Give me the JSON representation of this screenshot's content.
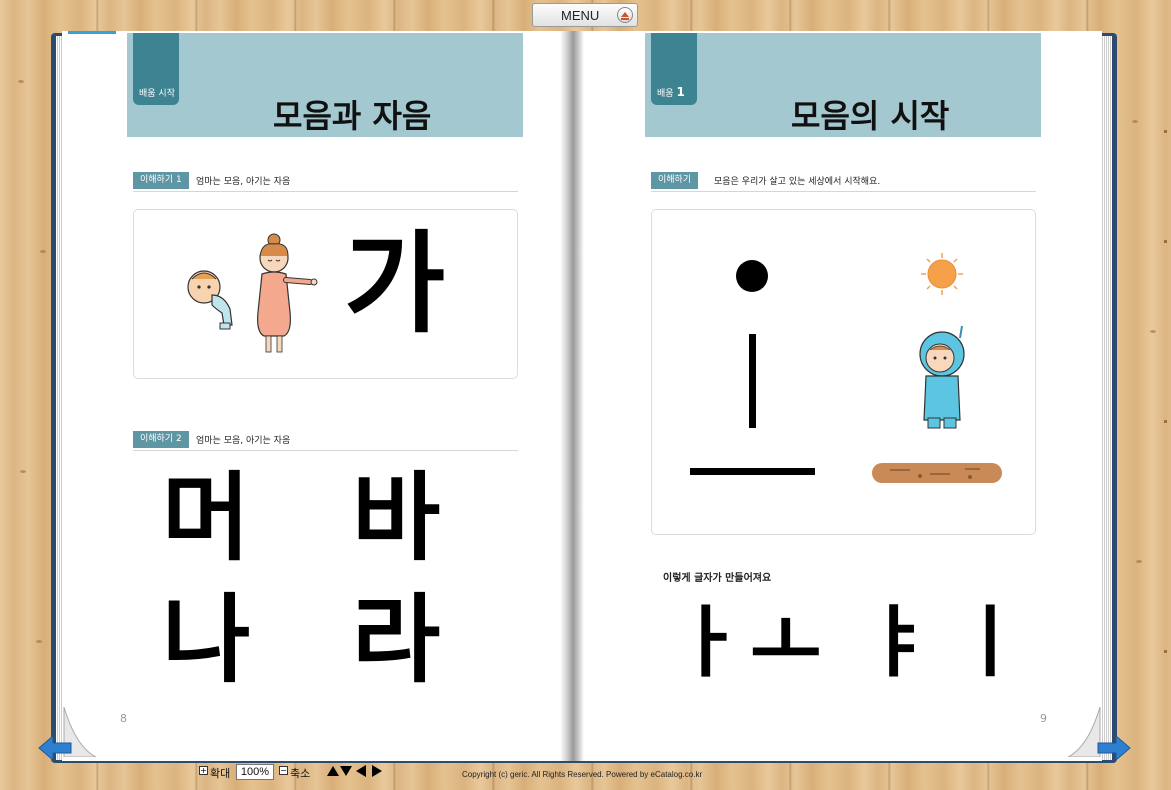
{
  "menu": {
    "label": "MENU",
    "icon": "eject-icon"
  },
  "left_page": {
    "tag": "배움 시작",
    "title": "모음과 자음",
    "section1": {
      "badge": "이해하기 1",
      "text": "엄마는 모음, 아기는 자음"
    },
    "illustration1_letter": "가",
    "section2": {
      "badge": "이해하기 2",
      "text": "엄마는 모음, 아기는 자음"
    },
    "letters": [
      "머",
      "바",
      "나",
      "라"
    ],
    "page_number": "8"
  },
  "right_page": {
    "tag": "배움",
    "tag_number": "1",
    "title": "모음의 시작",
    "section": {
      "badge": "이해하기",
      "text": "모음은 우리가 살고 있는 세상에서 시작해요."
    },
    "caption": "이렇게 글자가 만들어져요",
    "vowels": [
      "ㅏ",
      "ㅗ",
      "ㅑ",
      "ㅣ"
    ],
    "page_number": "9"
  },
  "toolbar": {
    "zoom_in_label": "확대",
    "zoom_value": "100%",
    "zoom_out_label": "축소",
    "copyright": "Copyright (c) geric. All Rights Reserved. Powered by eCatalog.co.kr"
  },
  "colors": {
    "header_band": "#a4c8cf",
    "header_tag": "#3e8391",
    "badge": "#5e96a4",
    "nav_arrow": "#2f7fd0"
  }
}
